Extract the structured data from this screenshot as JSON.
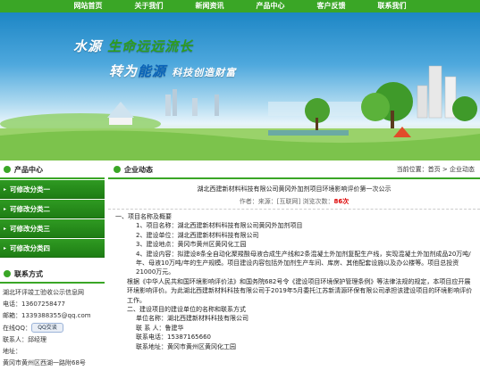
{
  "nav": {
    "items": [
      "网站首页",
      "关于我们",
      "新闻资讯",
      "产品中心",
      "客户反馈",
      "联系我们"
    ]
  },
  "banner": {
    "slogan1_a": "水源",
    "slogan1_b": "生命远远流长",
    "slogan2_a": "转为",
    "slogan2_b": "能源",
    "slogan2_c": "科技创造财富"
  },
  "sidebar": {
    "product_title": "产品中心",
    "items": [
      "可修改分类一",
      "可修改分类二",
      "可修改分类三",
      "可修改分类四"
    ],
    "contact_title": "联系方式",
    "contact": {
      "company": "湖北环评竣工验收公示信息网",
      "phone": "电话：13607258477",
      "email": "邮箱：1339388355@qq.com",
      "qq_label": "在线QQ：",
      "qq_button": "QQ交谈",
      "contact_person": "联系人：邱经理",
      "address_label": "地址：",
      "address": "黄冈市黄州区西湖一路附68号"
    }
  },
  "content": {
    "tab_title": "企业动态",
    "breadcrumb": "当前位置：首页 > 企业动态",
    "article_title": "湖北西建新材料科技有限公司黄冈外加剂项目环境影响评价第一次公示",
    "meta_prefix": "作者：来源：",
    "meta_source": "[互联网]",
    "meta_hits_label": "浏览次数：",
    "meta_hits": "86次",
    "paragraphs": [
      {
        "cls": "",
        "text": "一、项目名称及概要"
      },
      {
        "cls": "indent2",
        "text": "1、项目名称：湖北西建新材料科技有限公司黄冈外加剂项目"
      },
      {
        "cls": "indent2",
        "text": "2、建设单位：湖北西建新材料科技有限公司"
      },
      {
        "cls": "indent2",
        "text": "3、建设地点：黄冈市黄州区黄冈化工园"
      },
      {
        "cls": "indent2",
        "text": "4、建设内容：拟建设8条全自动化聚羧酸母液合成生产线和2条混凝土外加剂复配生产线，实现混凝土外加剂成品20万吨/年、母液10万吨/年的生产规模。项目建设内容包括外加剂生产车间、库房、其他配套设施以及办公楼等。项目总投资21000万元。"
      },
      {
        "cls": "indent1",
        "text": "根据《中华人民共和国环境影响评价法》和国务院682号令《建设项目环境保护管理条例》等法律法规的规定，本项目应开展环境影响评价。为此湖北西建新材料科技有限公司于2019年5月委托江苏新清源环保有限公司承担该建设项目的环境影响评价工作。"
      },
      {
        "cls": "indent1",
        "text": "二、建设项目的建设单位的名称和联系方式"
      },
      {
        "cls": "indent2",
        "text": "单位名称：湖北西建新材料科技有限公司"
      },
      {
        "cls": "indent2",
        "text": "联 系 人：鲁建华"
      },
      {
        "cls": "indent2",
        "text": "联系电话：15387165660"
      },
      {
        "cls": "indent2",
        "text": "联系地址：黄冈市黄州区黄冈化工园"
      }
    ]
  }
}
